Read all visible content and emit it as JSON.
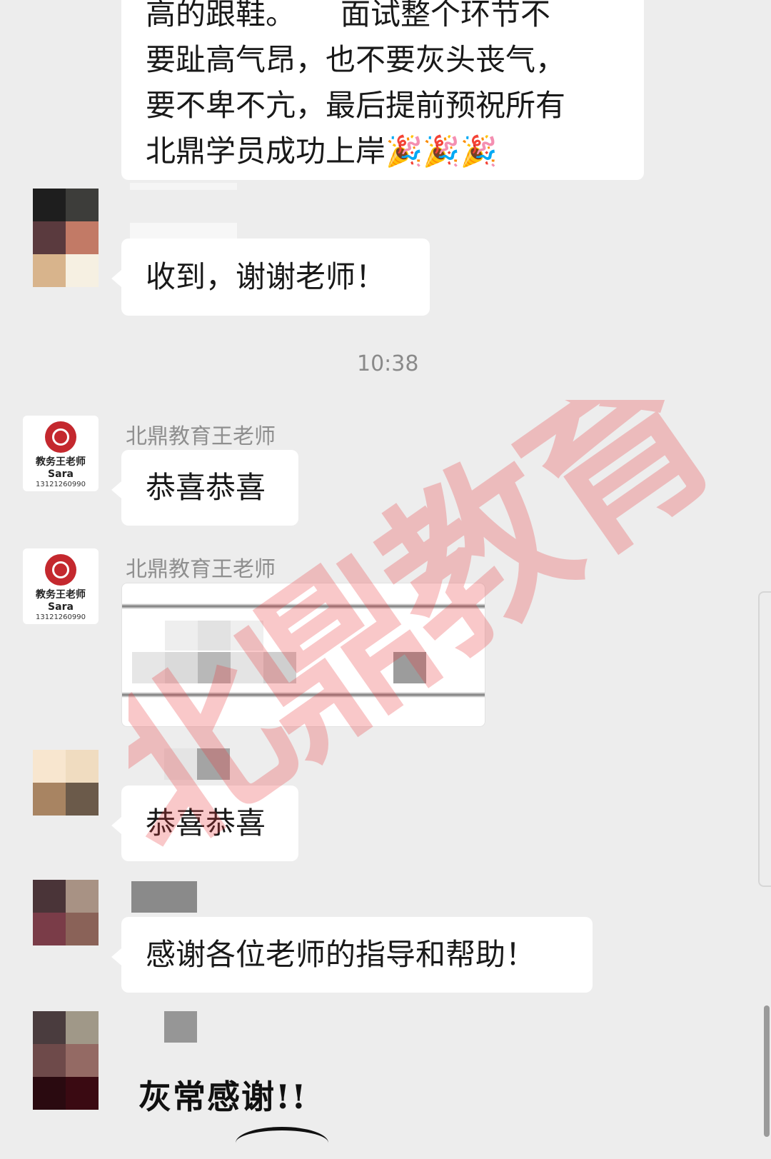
{
  "messages": {
    "m1": {
      "lines": [
        "高的跟鞋。　　面试整个环节不",
        "要趾高气昂，也不要灰头丧气，",
        "要不卑不亢，最后提前预祝所有",
        "北鼎学员成功上岸🎉🎉🎉"
      ]
    },
    "m2": {
      "text": "收到，谢谢老师！"
    },
    "timestamp": "10:38",
    "m3": {
      "sender": "北鼎教育王老师",
      "text": "恭喜恭喜"
    },
    "m4": {
      "sender": "北鼎教育王老师"
    },
    "m5": {
      "text": "恭喜恭喜"
    },
    "m6": {
      "text": "感谢各位老师的指导和帮助！"
    },
    "m7": {
      "sticker_text": "灰常感谢!!"
    }
  },
  "teacher_avatar": {
    "line1": "教务王老师",
    "line2": "Sara",
    "line3": "13121260990"
  },
  "watermark": {
    "text": "北鼎教育",
    "color": "#e8383d"
  },
  "colors": {
    "background": "#ededed",
    "bubble": "#ffffff",
    "sender_name": "#8f8f8f"
  }
}
